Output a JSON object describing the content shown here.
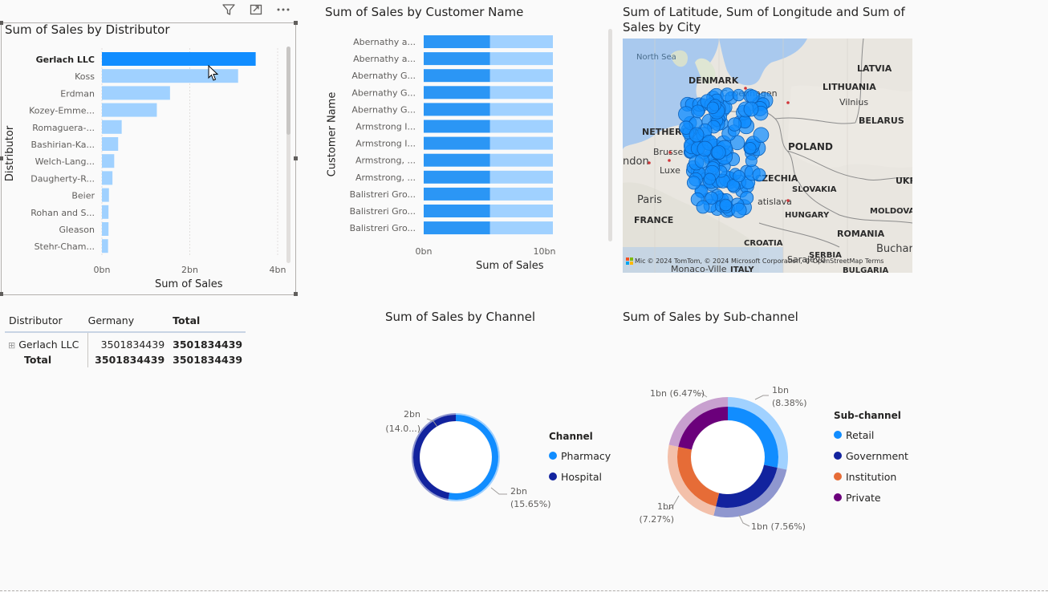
{
  "header_icons": [
    "filter-icon",
    "focus-mode-icon",
    "more-options-icon"
  ],
  "distributor_chart": {
    "title": "Sum of Sales by Distributor",
    "xlabel": "Sum of Sales",
    "ylabel": "Distributor"
  },
  "customer_chart": {
    "title": "Sum of Sales by Customer Name",
    "xlabel": "Sum of Sales",
    "ylabel": "Customer Name"
  },
  "map": {
    "title_line1": "Sum of Latitude, Sum of Longitude and Sum of",
    "title_line2": "Sales by City",
    "labels": {
      "north_sea": "North Sea",
      "latvia": "LATVIA",
      "denmark": "DENMARK",
      "copenhagen": "Copenhagen",
      "lithuania": "LITHUANIA",
      "vilnius": "Vilnius",
      "belarus": "BELARUS",
      "netherlands": "NETHERLAN",
      "brussels": "Brusse",
      "london": "ndon",
      "luxembourg": "Luxe",
      "poland": "POLAND",
      "czechia": "CZECHIA",
      "slovakia": "SLOVAKIA",
      "ukraine": "UKR",
      "paris": "Paris",
      "france": "FRANCE",
      "bratislava": "atislava",
      "hungary": "HUNGARY",
      "moldova": "MOLDOVA",
      "romania": "ROMANIA",
      "croatia": "CROATIA",
      "serbia": "SERBIA",
      "bucharest": "Buchar",
      "sarajevo": "Sarajevo",
      "monaco": "Monaco-Ville",
      "italy": "ITALY",
      "bulgaria": "BULGARIA"
    },
    "attribution": "© 2024 TomTom, © 2024 Microsoft Corporation, © OpenStreetMap  Terms",
    "ms_logo_text": "Mic"
  },
  "matrix": {
    "headers": [
      "Distributor",
      "Germany",
      "Total"
    ],
    "rows": [
      {
        "name": "Gerlach LLC",
        "germany": "3501834439",
        "total": "3501834439"
      }
    ],
    "total_row": {
      "name": "Total",
      "germany": "3501834439",
      "total": "3501834439"
    },
    "expand_icon": "⊞"
  },
  "channel_chart": {
    "title": "Sum of Sales by Channel",
    "legend_title": "Channel",
    "legend": [
      {
        "name": "Pharmacy",
        "color": "#118dff"
      },
      {
        "name": "Hospital",
        "color": "#12239e"
      }
    ],
    "labels": {
      "hospital_top": "2bn",
      "hospital_bottom": "(14.0...)",
      "pharmacy_top": "2bn",
      "pharmacy_bottom": "(15.65%)"
    }
  },
  "subchannel_chart": {
    "title": "Sum of Sales by Sub-channel",
    "legend_title": "Sub-channel",
    "legend": [
      {
        "name": "Retail",
        "color": "#118dff"
      },
      {
        "name": "Government",
        "color": "#12239e"
      },
      {
        "name": "Institution",
        "color": "#e66c37"
      },
      {
        "name": "Private",
        "color": "#6b007b"
      }
    ],
    "labels": {
      "retail_top": "1bn",
      "retail_bottom": "(8.38%)",
      "private": "1bn (6.47%)",
      "institution_top": "1bn",
      "institution_bottom": "(7.27%)",
      "government": "1bn (7.56%)"
    }
  },
  "chart_data": [
    {
      "type": "bar",
      "orientation": "horizontal",
      "title": "Sum of Sales by Distributor",
      "xlabel": "Sum of Sales",
      "ylabel": "Distributor",
      "categories": [
        "Gerlach LLC",
        "Koss",
        "Erdman",
        "Kozey-Emme...",
        "Romaguera-...",
        "Bashirian-Ka...",
        "Welch-Lang...",
        "Daugherty-R...",
        "Beier",
        "Rohan and S...",
        "Gleason",
        "Stehr-Cham..."
      ],
      "values": [
        3.5,
        3.1,
        1.55,
        1.25,
        0.45,
        0.37,
        0.28,
        0.24,
        0.16,
        0.15,
        0.15,
        0.14
      ],
      "value_unit": "bn",
      "selected": "Gerlach LLC",
      "xticks": [
        "0bn",
        "2bn",
        "4bn"
      ],
      "xlim": [
        0,
        4
      ],
      "colors": {
        "selected": "#118dff",
        "other": "#a0d1ff"
      }
    },
    {
      "type": "bar",
      "orientation": "horizontal",
      "stacked": true,
      "title": "Sum of Sales by Customer Name",
      "xlabel": "Sum of Sales",
      "ylabel": "Customer Name",
      "categories": [
        "Abernathy a...",
        "Abernathy a...",
        "Abernathy G...",
        "Abernathy G...",
        "Abernathy G...",
        "Armstrong I...",
        "Armstrong I...",
        "Armstrong, ...",
        "Armstrong, ...",
        "Balistreri Gro...",
        "Balistreri Gro...",
        "Balistreri Gro..."
      ],
      "series": [
        {
          "values": [
            5.5,
            5.5,
            5.5,
            5.5,
            5.5,
            5.5,
            5.5,
            5.5,
            5.5,
            5.5,
            5.5,
            5.5
          ]
        },
        {
          "values": [
            5.2,
            5.2,
            5.2,
            5.2,
            5.2,
            5.2,
            5.2,
            5.2,
            5.2,
            5.2,
            5.2,
            5.2
          ]
        }
      ],
      "value_unit": "bn",
      "xticks": [
        "0bn",
        "10bn"
      ],
      "xlim": [
        0,
        10.5
      ],
      "colors": [
        "#2b96f5",
        "#a0d1ff"
      ]
    },
    {
      "type": "pie",
      "donut": true,
      "title": "Sum of Sales by Channel",
      "categories": [
        "Pharmacy",
        "Hospital"
      ],
      "values": [
        52.8,
        47.2
      ],
      "data_labels": [
        "2bn (15.65%)",
        "2bn (14.0...)"
      ],
      "colors": [
        "#118dff",
        "#12239e"
      ]
    },
    {
      "type": "pie",
      "donut": true,
      "title": "Sum of Sales by Sub-channel",
      "categories": [
        "Retail",
        "Government",
        "Institution",
        "Private"
      ],
      "values": [
        28.3,
        25.5,
        24.5,
        21.7
      ],
      "data_labels": [
        "1bn (8.38%)",
        "1bn (7.56%)",
        "1bn (7.27%)",
        "1bn (6.47%)"
      ],
      "colors": [
        "#118dff",
        "#12239e",
        "#e66c37",
        "#6b007b"
      ]
    }
  ]
}
